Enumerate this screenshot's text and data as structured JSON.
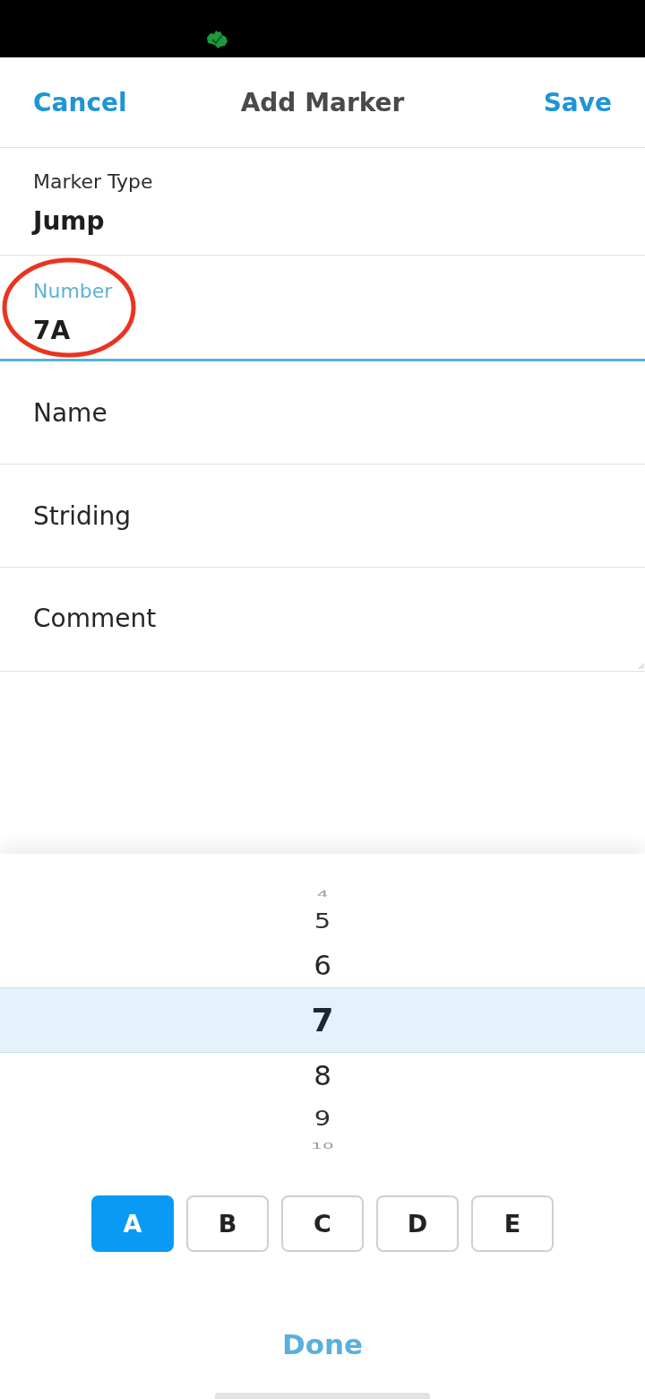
{
  "header": {
    "cancel": "Cancel",
    "title": "Add Marker",
    "save": "Save"
  },
  "fields": [
    {
      "kind": "select",
      "label": "Marker Type",
      "value": "Jump",
      "focused": false,
      "circled": false
    },
    {
      "kind": "text",
      "label": "Number",
      "value": "7A",
      "focused": true,
      "circled": true
    },
    {
      "kind": "input",
      "placeholder": "Name",
      "focused": false,
      "circled": false
    },
    {
      "kind": "input",
      "placeholder": "Striding",
      "focused": false,
      "circled": false
    },
    {
      "kind": "textarea",
      "placeholder": "Comment",
      "focused": false,
      "circled": false
    }
  ],
  "picker": {
    "items": [
      {
        "label": "4",
        "selected": false
      },
      {
        "label": "5",
        "selected": false
      },
      {
        "label": "6",
        "selected": false
      },
      {
        "label": "7",
        "selected": true
      },
      {
        "label": "8",
        "selected": false
      },
      {
        "label": "9",
        "selected": false
      },
      {
        "label": "10",
        "selected": false
      }
    ]
  },
  "suffix_buttons": [
    {
      "label": "A",
      "selected": true
    },
    {
      "label": "B",
      "selected": false
    },
    {
      "label": "C",
      "selected": false
    },
    {
      "label": "D",
      "selected": false
    },
    {
      "label": "E",
      "selected": false
    }
  ],
  "done": "Done"
}
